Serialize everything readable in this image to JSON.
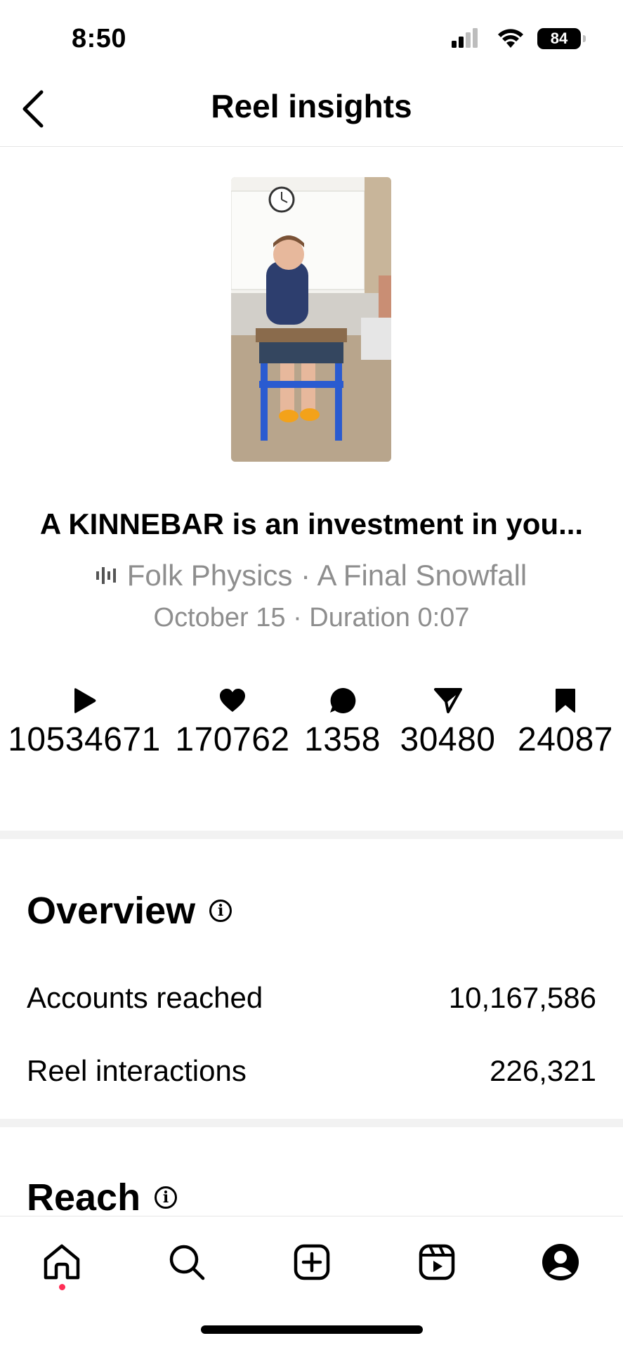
{
  "status_bar": {
    "time": "8:50",
    "battery": "84"
  },
  "header": {
    "title": "Reel insights",
    "back_icon": "chevron-left-icon"
  },
  "reel": {
    "title": "A KINNEBAR is an investment in you...",
    "audio": "Folk Physics · A Final Snowfall",
    "date_duration": "October 15 · Duration 0:07"
  },
  "metrics": [
    {
      "icon": "play-icon",
      "value": "10534671"
    },
    {
      "icon": "heart-icon",
      "value": "170762"
    },
    {
      "icon": "comment-icon",
      "value": "1358"
    },
    {
      "icon": "share-icon",
      "value": "30480"
    },
    {
      "icon": "bookmark-icon",
      "value": "24087"
    }
  ],
  "overview": {
    "title": "Overview",
    "rows": [
      {
        "label": "Accounts reached",
        "value": "10,167,586"
      },
      {
        "label": "Reel interactions",
        "value": "226,321"
      }
    ]
  },
  "reach": {
    "title": "Reach"
  },
  "bottom_nav": [
    "home-icon",
    "search-icon",
    "create-icon",
    "reels-icon",
    "profile-icon"
  ],
  "colors": {
    "muted": "#8e8e8e",
    "notification_dot": "#ff2d55"
  }
}
